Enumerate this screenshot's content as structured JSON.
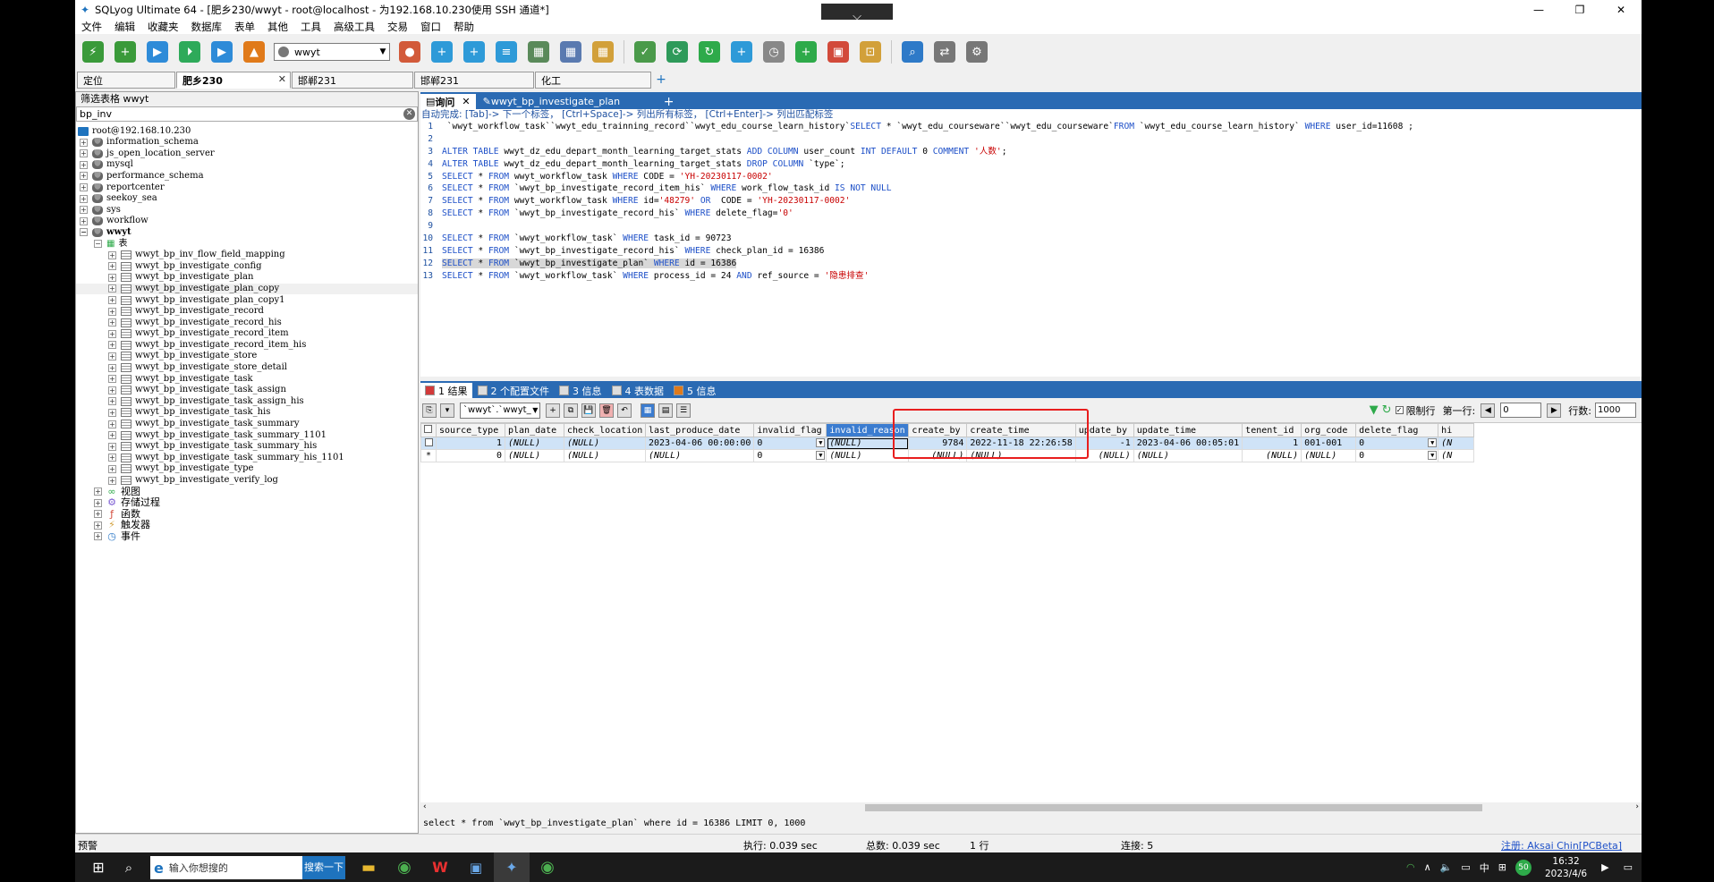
{
  "window": {
    "title": "SQLyog Ultimate 64 - [肥乡230/wwyt - root@localhost - 为192.168.10.230使用 SSH 通道*]",
    "dropdown_glyph": "⌵",
    "controls": [
      "—",
      "❐",
      "✕"
    ]
  },
  "menu": [
    "文件",
    "编辑",
    "收藏夹",
    "数据库",
    "表单",
    "其他",
    "工具",
    "高级工具",
    "交易",
    "窗口",
    "帮助"
  ],
  "toolbar": {
    "db_selector": "wwyt",
    "icons": [
      {
        "name": "new-connection-icon",
        "color": "#3a9a3a",
        "glyph": "⚡"
      },
      {
        "name": "new-query-icon",
        "color": "#3a9a3a",
        "glyph": "+"
      },
      {
        "name": "execute-query-icon",
        "color": "#2e8bd8",
        "glyph": "▶"
      },
      {
        "name": "execute-all-icon",
        "color": "#2eaa5a",
        "glyph": "⏵"
      },
      {
        "name": "execute-edit-icon",
        "color": "#2e8bd8",
        "glyph": "▶"
      },
      {
        "name": "schema-sync-icon",
        "color": "#e07a1a",
        "glyph": "▲"
      }
    ],
    "icons2": [
      {
        "name": "user-manager-icon",
        "color": "#d25a3a",
        "glyph": "●"
      },
      {
        "name": "create-db-icon",
        "color": "#2e9ad8",
        "glyph": "+"
      },
      {
        "name": "alter-db-icon",
        "color": "#2e9ad8",
        "glyph": "+"
      },
      {
        "name": "backup-icon",
        "color": "#2e9ad8",
        "glyph": "≡"
      },
      {
        "name": "table-data-icon",
        "color": "#5a8a5a",
        "glyph": "▦"
      },
      {
        "name": "table-schema-icon",
        "color": "#5a7ab0",
        "glyph": "▦"
      },
      {
        "name": "table-report-icon",
        "color": "#d2a03a",
        "glyph": "▦"
      }
    ],
    "icons3": [
      {
        "name": "import-icon",
        "color": "#4a9a4a",
        "glyph": "✓"
      },
      {
        "name": "data-sync-icon",
        "color": "#2e9a5a",
        "glyph": "⟳"
      },
      {
        "name": "refresh-icon",
        "color": "#2eaa4a",
        "glyph": "↻"
      },
      {
        "name": "copy-db-icon",
        "color": "#2e9ad8",
        "glyph": "+"
      },
      {
        "name": "scheduler-icon",
        "color": "#888888",
        "glyph": "◷"
      },
      {
        "name": "query-builder-icon",
        "color": "#2eaa4a",
        "glyph": "+"
      },
      {
        "name": "schema-designer-icon",
        "color": "#d24a3a",
        "glyph": "▣"
      },
      {
        "name": "notification-icon",
        "color": "#d2a03a",
        "glyph": "⊡"
      }
    ],
    "icons4": [
      {
        "name": "db-search-icon",
        "color": "#2e7ac8",
        "glyph": "⌕"
      },
      {
        "name": "db-compare-icon",
        "color": "#777777",
        "glyph": "⇄"
      },
      {
        "name": "db-settings-icon",
        "color": "#777777",
        "glyph": "⚙"
      }
    ]
  },
  "connection_tabs": [
    {
      "label": "定位",
      "active": false
    },
    {
      "label": "肥乡230",
      "active": true
    },
    {
      "label": "邯郸231",
      "active": false
    },
    {
      "label": "邯郸231",
      "active": false
    },
    {
      "label": "化工",
      "active": false
    }
  ],
  "left_panel": {
    "header": "筛选表格 wwyt",
    "filter_value": "bp_inv",
    "server": "root@192.168.10.230",
    "databases": [
      "information_schema",
      "js_open_location_server",
      "mysql",
      "performance_schema",
      "reportcenter",
      "seekoy_sea",
      "sys",
      "workflow"
    ],
    "current_db": "wwyt",
    "tables_folder": "表",
    "tables": [
      "wwyt_bp_inv_flow_field_mapping",
      "wwyt_bp_investigate_config",
      "wwyt_bp_investigate_plan",
      "wwyt_bp_investigate_plan_copy",
      "wwyt_bp_investigate_plan_copy1",
      "wwyt_bp_investigate_record",
      "wwyt_bp_investigate_record_his",
      "wwyt_bp_investigate_record_item",
      "wwyt_bp_investigate_record_item_his",
      "wwyt_bp_investigate_store",
      "wwyt_bp_investigate_store_detail",
      "wwyt_bp_investigate_task",
      "wwyt_bp_investigate_task_assign",
      "wwyt_bp_investigate_task_assign_his",
      "wwyt_bp_investigate_task_his",
      "wwyt_bp_investigate_task_summary",
      "wwyt_bp_investigate_task_summary_1101",
      "wwyt_bp_investigate_task_summary_his",
      "wwyt_bp_investigate_task_summary_his_1101",
      "wwyt_bp_investigate_type",
      "wwyt_bp_investigate_verify_log"
    ],
    "selected_table_index": 3,
    "other_folders": [
      {
        "label": "视图",
        "icon": "view-icon",
        "glyph": "∞",
        "color": "#2eaa4a"
      },
      {
        "label": "存储过程",
        "icon": "procedure-icon",
        "glyph": "⚙",
        "color": "#7a5ad2"
      },
      {
        "label": "函数",
        "icon": "function-icon",
        "glyph": "ƒ",
        "color": "#d24a3a"
      },
      {
        "label": "触发器",
        "icon": "trigger-icon",
        "glyph": "⚡",
        "color": "#d2a03a"
      },
      {
        "label": "事件",
        "icon": "event-icon",
        "glyph": "◷",
        "color": "#2e7ac8"
      }
    ]
  },
  "editor_tabs": [
    {
      "label": "询问",
      "active": true
    },
    {
      "label": "wwyt_bp_investigate_plan",
      "active": false
    }
  ],
  "editor": {
    "hint": "自动完成:  [Tab]-> 下一个标签， [Ctrl+Space]-> 列出所有标签， [Ctrl+Enter]-> 列出匹配标签",
    "lines": [
      {
        "no": "1",
        "parts": [
          [
            "t",
            " `wwyt_workflow_task``wwyt_edu_trainning_record``wwyt_edu_course_learn_history`"
          ],
          [
            "k",
            "SELECT"
          ],
          [
            "t",
            " * `wwyt_edu_courseware``wwyt_edu_courseware`"
          ],
          [
            "k",
            "FROM"
          ],
          [
            "t",
            " `wwyt_edu_course_learn_history` "
          ],
          [
            "k",
            "WHERE"
          ],
          [
            "t",
            " user_id=11608 ;"
          ]
        ]
      },
      {
        "no": "2",
        "parts": []
      },
      {
        "no": "3",
        "parts": [
          [
            "k",
            "ALTER TABLE"
          ],
          [
            "t",
            " wwyt_dz_edu_depart_month_learning_target_stats "
          ],
          [
            "k",
            "ADD COLUMN"
          ],
          [
            "t",
            " user_count "
          ],
          [
            "k",
            "INT DEFAULT"
          ],
          [
            "t",
            " 0 "
          ],
          [
            "k",
            "COMMENT"
          ],
          [
            "s",
            " '人数'"
          ],
          [
            "t",
            ";"
          ]
        ]
      },
      {
        "no": "4",
        "parts": [
          [
            "k",
            "ALTER TABLE"
          ],
          [
            "t",
            " wwyt_dz_edu_depart_month_learning_target_stats "
          ],
          [
            "k",
            "DROP COLUMN"
          ],
          [
            "t",
            " `type`;"
          ]
        ]
      },
      {
        "no": "5",
        "parts": [
          [
            "k",
            "SELECT"
          ],
          [
            "t",
            " * "
          ],
          [
            "k",
            "FROM"
          ],
          [
            "t",
            " wwyt_workflow_task "
          ],
          [
            "k",
            "WHERE"
          ],
          [
            "t",
            " CODE = "
          ],
          [
            "s",
            "'YH-20230117-0002'"
          ]
        ]
      },
      {
        "no": "6",
        "parts": [
          [
            "k",
            "SELECT"
          ],
          [
            "t",
            " * "
          ],
          [
            "k",
            "FROM"
          ],
          [
            "t",
            " `wwyt_bp_investigate_record_item_his` "
          ],
          [
            "k",
            "WHERE"
          ],
          [
            "t",
            " work_flow_task_id "
          ],
          [
            "k",
            "IS NOT NULL"
          ]
        ]
      },
      {
        "no": "7",
        "parts": [
          [
            "k",
            "SELECT"
          ],
          [
            "t",
            " * "
          ],
          [
            "k",
            "FROM"
          ],
          [
            "t",
            " wwyt_workflow_task "
          ],
          [
            "k",
            "WHERE"
          ],
          [
            "t",
            " id="
          ],
          [
            "s",
            "'48279'"
          ],
          [
            "t",
            " "
          ],
          [
            "k",
            "OR"
          ],
          [
            "t",
            "  CODE = "
          ],
          [
            "s",
            "'YH-20230117-0002'"
          ]
        ]
      },
      {
        "no": "8",
        "parts": [
          [
            "k",
            "SELECT"
          ],
          [
            "t",
            " * "
          ],
          [
            "k",
            "FROM"
          ],
          [
            "t",
            " `wwyt_bp_investigate_record_his` "
          ],
          [
            "k",
            "WHERE"
          ],
          [
            "t",
            " delete_flag="
          ],
          [
            "s",
            "'0'"
          ]
        ]
      },
      {
        "no": "9",
        "parts": []
      },
      {
        "no": "10",
        "parts": [
          [
            "k",
            "SELECT"
          ],
          [
            "t",
            " * "
          ],
          [
            "k",
            "FROM"
          ],
          [
            "t",
            " `wwyt_workflow_task` "
          ],
          [
            "k",
            "WHERE"
          ],
          [
            "t",
            " task_id = 90723"
          ]
        ]
      },
      {
        "no": "11",
        "parts": [
          [
            "k",
            "SELECT"
          ],
          [
            "t",
            " * "
          ],
          [
            "k",
            "FROM"
          ],
          [
            "t",
            " `wwyt_bp_investigate_record_his` "
          ],
          [
            "k",
            "WHERE"
          ],
          [
            "t",
            " check_plan_id = 16386"
          ]
        ]
      },
      {
        "no": "12",
        "hl": true,
        "parts": [
          [
            "k",
            "SELECT"
          ],
          [
            "t",
            " * "
          ],
          [
            "k",
            "FROM"
          ],
          [
            "t",
            " `wwyt_bp_investigate_plan` "
          ],
          [
            "k",
            "WHERE"
          ],
          [
            "t",
            " id = 16386"
          ]
        ]
      },
      {
        "no": "13",
        "parts": [
          [
            "k",
            "SELECT"
          ],
          [
            "t",
            " * "
          ],
          [
            "k",
            "FROM"
          ],
          [
            "t",
            " `wwyt_workflow_task` "
          ],
          [
            "k",
            "WHERE"
          ],
          [
            "t",
            " process_id = 24 "
          ],
          [
            "k",
            "AND"
          ],
          [
            "t",
            " ref_source = "
          ],
          [
            "s",
            "'隐患排查'"
          ]
        ]
      }
    ]
  },
  "result_tabs": [
    {
      "label": "1 结果",
      "active": true,
      "icon": "result-grid-icon",
      "color": "#d23a3a"
    },
    {
      "label": "2 个配置文件",
      "active": false,
      "icon": "profile-icon",
      "color": "#dddddd"
    },
    {
      "label": "3 信息",
      "active": false,
      "icon": "info-icon",
      "color": "#dddddd"
    },
    {
      "label": "4 表数据",
      "active": false,
      "icon": "table-data-tab-icon",
      "color": "#dddddd"
    },
    {
      "label": "5 信息",
      "active": false,
      "icon": "info2-icon",
      "color": "#e07a1a"
    }
  ],
  "result_toolbar": {
    "table_selector": "`wwyt`.`wwyt_",
    "limit_label": "限制行",
    "first_row_label": "第一行:",
    "first_row_value": "0",
    "rows_label": "行数:",
    "rows_value": "1000"
  },
  "grid": {
    "columns": [
      "source_type",
      "plan_date",
      "check_location",
      "last_produce_date",
      "invalid_flag",
      "invalid_reason",
      "create_by",
      "create_time",
      "update_by",
      "update_time",
      "tenent_id",
      "org_code",
      "delete_flag",
      "hi"
    ],
    "selected_column": "invalid_reason",
    "rows": [
      [
        "1",
        "(NULL)",
        "(NULL)",
        "2023-04-06 00:00:00",
        "0",
        "(NULL)",
        "9784",
        "2022-11-18 22:26:58",
        "-1",
        "2023-04-06 00:05:01",
        "1",
        "001-001",
        "0",
        "(N"
      ],
      [
        "0",
        "(NULL)",
        "(NULL)",
        "(NULL)",
        "0",
        "(NULL)",
        "(NULL)",
        "(NULL)",
        "(NULL)",
        "(NULL)",
        "(NULL)",
        "(NULL)",
        "0",
        "(N"
      ]
    ],
    "new_row_marker": "*"
  },
  "sql_status": "select * from `wwyt_bp_investigate_plan` where id = 16386 LIMIT 0, 1000",
  "status_bar": {
    "left": "预警",
    "exec": "执行: 0.039 sec",
    "total": "总数: 0.039 sec",
    "rows": "1 行",
    "conn": "连接: 5",
    "reg": "注册:  Aksai Chin[PCBeta]"
  },
  "taskbar": {
    "search_placeholder": "输入你想搜的",
    "search_button": "搜索一下",
    "time": "16:32",
    "date": "2023/4/6",
    "ime": "中",
    "badge": "50"
  }
}
